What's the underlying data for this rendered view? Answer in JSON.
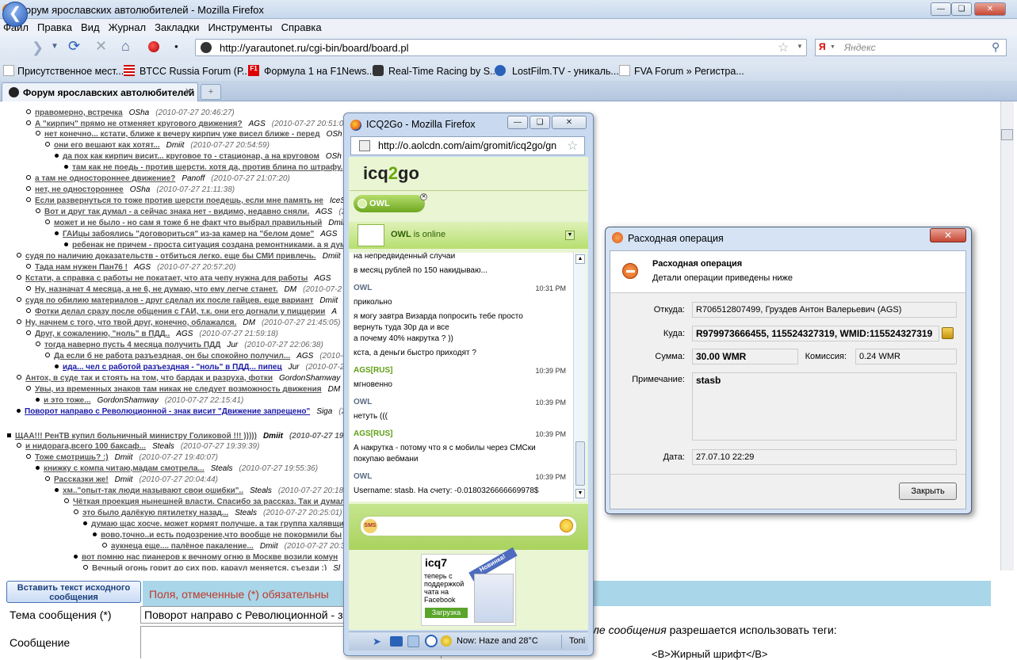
{
  "browser": {
    "window_title": "Форум ярославских автолюбителей - Mozilla Firefox",
    "menu": [
      "Файл",
      "Правка",
      "Вид",
      "Журнал",
      "Закладки",
      "Инструменты",
      "Справка"
    ],
    "url": "http://yarautonet.ru/cgi-bin/board/board.pl",
    "search_placeholder": "Яндекс",
    "bookmarks": [
      "Присутственное мест...",
      "BTCC Russia Forum (Р...",
      "Формула 1 на F1News...",
      "Real-Time Racing by S...",
      "LostFilm.TV - уникаль...",
      "FVA Forum » Регистра..."
    ],
    "tab_title": "Форум ярославских автолюбителей"
  },
  "forum": {
    "rows": [
      {
        "text": "правомерно, встречка",
        "author": "OSha",
        "date": "(2010-07-27 20:46:27)"
      },
      {
        "text": "А \"кирпич\" прямо не отменяет кругового движения?",
        "author": "AGS",
        "date": "(2010-07-27 20:51:08)"
      },
      {
        "text": "нет конечно... кстати, ближе к вечеру кирпич уже висел ближе - перед",
        "author": "OSh",
        "date": ""
      },
      {
        "text": "они его вешают как хотят...",
        "author": "Dmiit",
        "date": "(2010-07-27 20:54:59)"
      },
      {
        "text": "да пох как кирпич висит... круговое то - стационар, а на круговом",
        "author": "OSh",
        "date": ""
      },
      {
        "text": "там как не поедь - против шерсти. хотя да, против блина по штрафу.",
        "author": "",
        "date": ""
      },
      {
        "text": "а там не одностороннее движение?",
        "author": "Panoff",
        "date": "(2010-07-27 21:07:20)"
      },
      {
        "text": "нет, не одностороннее",
        "author": "OSha",
        "date": "(2010-07-27 21:11:38)"
      },
      {
        "text": "Если развернуться то тоже против шерсти поедешь, если мне память не",
        "author": "IceS",
        "date": ""
      },
      {
        "text": "Вот и друг так думал - а сейчас знака нет - видимо, недавно сняли.",
        "author": "AGS",
        "date": "(2010-07-2"
      },
      {
        "text": "может и не было - но сам я тоже б не факт что выбрал правильный",
        "author": "Dmiit",
        "date": ""
      },
      {
        "text": "ГАИцы забоялись \"договориться\" из-за камер на \"белом доме\"",
        "author": "AGS",
        "date": ""
      },
      {
        "text": "ребенак не причем - проста ситуация создана ремонтниками. а я дум",
        "author": "",
        "date": ""
      },
      {
        "text": "судя по наличию доказательств - отбиться легко. еще бы СМИ привлечь.",
        "author": "Dmiit",
        "date": ""
      },
      {
        "text": "Тада нам нужен Пан76 !",
        "author": "AGS",
        "date": "(2010-07-27 20:57:20)"
      },
      {
        "text": "Кстати, а справка с работы не покатает, что ата чепу нужна для работы",
        "author": "AGS",
        "date": ""
      },
      {
        "text": "Ну, назначат 4 месяца, а не 6, не думаю, что ему легче станет.",
        "author": "DM",
        "date": "(2010-07-2"
      },
      {
        "text": "судя по обилию материалов - друг сделал их после гайцев. еще вариант",
        "author": "Dmiit",
        "date": ""
      },
      {
        "text": "Фотки делал сразу после общения с ГАИ, т.к. они его догнали у пиццерии",
        "author": "A",
        "date": ""
      },
      {
        "text": "Ну, начнем с того, что твой друг, конечно, облажался.",
        "author": "DM",
        "date": "(2010-07-27 21:45:05)"
      },
      {
        "text": "Друг, к сожалению, \"ноль\" в ПДД..",
        "author": "AGS",
        "date": "(2010-07-27 21:59:18)"
      },
      {
        "text": "тогда наверно пусть 4 месяца получить ПДД",
        "author": "Jur",
        "date": "(2010-07-27 22:06:38)"
      },
      {
        "text": "Да если б не работа разъездная, он бы спокойно получил...",
        "author": "AGS",
        "date": "(2010-07"
      },
      {
        "text": "ида... чел с работой разъездная - \"ноль\" в ПДД... пипец",
        "author": "Jur",
        "date": "(2010-07-27"
      },
      {
        "text": "Антох, в суде так и стоять на том, что бардак и разруха, фотки",
        "author": "GordonShamway",
        "date": "(2010-"
      },
      {
        "text": "Увы, из временных знаков там никак не следует возможность движения",
        "author": "DM",
        "date": "(2010-07"
      },
      {
        "text": "и это тоже...",
        "author": "GordonShamway",
        "date": "(2010-07-27 22:15:41)"
      },
      {
        "text": "Поворот направо с Революционной - знак висит \"Движение запрещено\"",
        "author": "Siga",
        "date": "(2010-07"
      },
      {
        "text": "ЩАА!!! РенТВ купил больничный министру Голиковой !!! )))))",
        "author": "Dmiit",
        "date": "(2010-07-27 19:37:"
      },
      {
        "text": "и нидорага,всего 100 баксаф...",
        "author": "Steals",
        "date": "(2010-07-27 19:39:39)"
      },
      {
        "text": "Тоже смотришь? :)",
        "author": "Dmiit",
        "date": "(2010-07-27 19:40:07)"
      },
      {
        "text": "книжку с компа читаю,мадам смотрела...",
        "author": "Steals",
        "date": "(2010-07-27 19:55:36)"
      },
      {
        "text": "Рассказки же!",
        "author": "Dmiit",
        "date": "(2010-07-27 20:04:44)"
      },
      {
        "text": "хм..\"опыт-так люди называют свои ошибки\"..",
        "author": "Steals",
        "date": "(2010-07-27 20:18:4"
      },
      {
        "text": "Чёткая проекция нынешней власти. Спасибо за рассказ. Так и думал,",
        "author": "",
        "date": ""
      },
      {
        "text": "это было далёкую пятилетку назад...",
        "author": "Steals",
        "date": "(2010-07-27 20:25:01)"
      },
      {
        "text": "думаю щас хосче. может кормят получше. а так группа халявщи",
        "author": "",
        "date": ""
      },
      {
        "text": "вово,точно..и есть подозрение,что вообще не покормили бы",
        "author": "",
        "date": ""
      },
      {
        "text": "аукнеца еще.... палёное пакаление...",
        "author": "Dmiit",
        "date": "(2010-07-27 20:3"
      },
      {
        "text": "вот помню нас пианеров к вечному огню в Москве возили комун",
        "author": "",
        "date": ""
      },
      {
        "text": "Вечный огонь горит до сих пор, караул меняется, съезди :)",
        "author": "Sl",
        "date": ""
      }
    ],
    "insert_quote_button": "Вставить текст исходного сообщения",
    "required_note": "Поля, отмеченные (*) обязательны",
    "subject_label": "Тема сообщения (*)",
    "subject_value": "Поворот направо с Революционной - з",
    "message_label": "Сообщение",
    "tags_note_italic": "ле сообщения",
    "tags_note_rest": " разрешается использовать теги:",
    "tags_example": "<B>Жирный шрифт</B>"
  },
  "icq": {
    "window_title": "ICQ2Go - Mozilla Firefox",
    "url": "http://o.aolcdn.com/aim/gromit/icq2go/gn",
    "logo_pre": "icq",
    "logo_num": "2",
    "logo_post": "go",
    "contact_tab": "OWL",
    "status_name": "OWL",
    "status_text": " is online",
    "messages": [
      {
        "name": "",
        "time": "",
        "lines": [
          "на непредвиденный случаи",
          "в месяц рублей по 150 накидываю..."
        ]
      },
      {
        "name": "OWL",
        "time": "10:31 PM",
        "lines": [
          "прикольно",
          "я могу завтра Визарда попросить тебе просто",
          "вернуть туда 30р да и все",
          "а почему 40% накрутка ? ))",
          "кста, а деньги быстро приходят ?"
        ]
      },
      {
        "name": "AGS[RUS]",
        "time": "10:39 PM",
        "lines": [
          "мгновенно"
        ]
      },
      {
        "name": "OWL",
        "time": "10:39 PM",
        "lines": [
          "нетуть ((("
        ]
      },
      {
        "name": "AGS[RUS]",
        "time": "10:39 PM",
        "lines": [
          "А накрутка - потому что я с мобилы через СМСки",
          "покупаю вебмани"
        ]
      },
      {
        "name": "OWL",
        "time": "10:39 PM",
        "lines": [
          "Username: stasb. На счету: -0.0180326666669978$",
          "((("
        ]
      }
    ],
    "ad_logo": "icq7",
    "ad_text": "теперь с поддержкой чата на Facebook",
    "ad_badge": "Новинка!",
    "ad_button": "Загрузка",
    "weather": "Now: Haze and 28°C",
    "weather_tail": "Toni"
  },
  "dialog": {
    "title": "Расходная операция",
    "header": "Расходная операция",
    "subheader": "Детали операции приведены ниже",
    "from_label": "Откуда:",
    "from_value": "R706512807499, Груздев Антон Валерьевич (AGS)",
    "to_label": "Куда:",
    "to_value": "R979973666455, 115524327319, WMID:115524327319",
    "sum_label": "Сумма:",
    "sum_value": "30.00 WMR",
    "fee_label": "Комиссия:",
    "fee_value": "0.24 WMR",
    "note_label": "Примечание:",
    "note_value": "stasb",
    "date_label": "Дата:",
    "date_value": "27.07.10 22:29",
    "close_button": "Закрыть"
  }
}
